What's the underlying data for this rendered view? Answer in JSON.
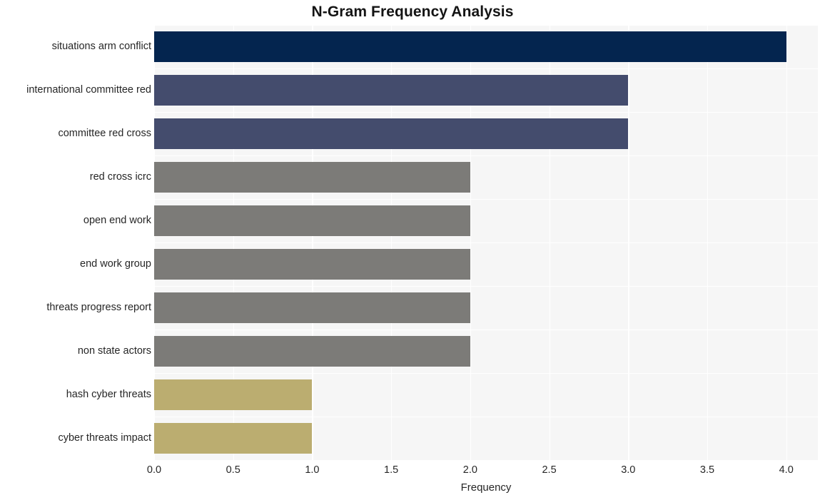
{
  "chart_data": {
    "type": "bar",
    "orientation": "horizontal",
    "title": "N-Gram Frequency Analysis",
    "xlabel": "Frequency",
    "ylabel": "",
    "xlim": [
      0.0,
      4.2
    ],
    "xticks": [
      "0.0",
      "0.5",
      "1.0",
      "1.5",
      "2.0",
      "2.5",
      "3.0",
      "3.5",
      "4.0"
    ],
    "xtick_values": [
      0.0,
      0.5,
      1.0,
      1.5,
      2.0,
      2.5,
      3.0,
      3.5,
      4.0
    ],
    "grid": true,
    "legend": "none",
    "categories": [
      "situations arm conflict",
      "international committee red",
      "committee red cross",
      "red cross icrc",
      "open end work",
      "end work group",
      "threats progress report",
      "non state actors",
      "hash cyber threats",
      "cyber threats impact"
    ],
    "values": [
      4,
      3,
      3,
      2,
      2,
      2,
      2,
      2,
      1,
      1
    ],
    "bar_colors": [
      "#042css",
      "#042a5c",
      "#042a5c",
      "#7c7b78",
      "#7c7b78",
      "#7c7b78",
      "#7c7b78",
      "#7c7b78",
      "#bbad70",
      "#bbad70"
    ],
    "colors": {
      "bar_high": "#04254f",
      "bar_mid": "#444c6d",
      "bar_gray": "#7c7b78",
      "bar_tan": "#bbad70",
      "plot_background": "#f6f6f6",
      "gridline": "#ffffff",
      "page_background": "#ffffff",
      "title_text": "#141414",
      "tick_text": "#262626"
    },
    "bars": [
      {
        "label": "situations arm conflict",
        "value": 4,
        "color": "#04254f"
      },
      {
        "label": "international committee red",
        "value": 3,
        "color": "#444c6d"
      },
      {
        "label": "committee red cross",
        "value": 3,
        "color": "#444c6d"
      },
      {
        "label": "red cross icrc",
        "value": 2,
        "color": "#7c7b78"
      },
      {
        "label": "open end work",
        "value": 2,
        "color": "#7c7b78"
      },
      {
        "label": "end work group",
        "value": 2,
        "color": "#7c7b78"
      },
      {
        "label": "threats progress report",
        "value": 2,
        "color": "#7c7b78"
      },
      {
        "label": "non state actors",
        "value": 2,
        "color": "#7c7b78"
      },
      {
        "label": "hash cyber threats",
        "value": 1,
        "color": "#bbad70"
      },
      {
        "label": "cyber threats impact",
        "value": 1,
        "color": "#bbad70"
      }
    ]
  }
}
